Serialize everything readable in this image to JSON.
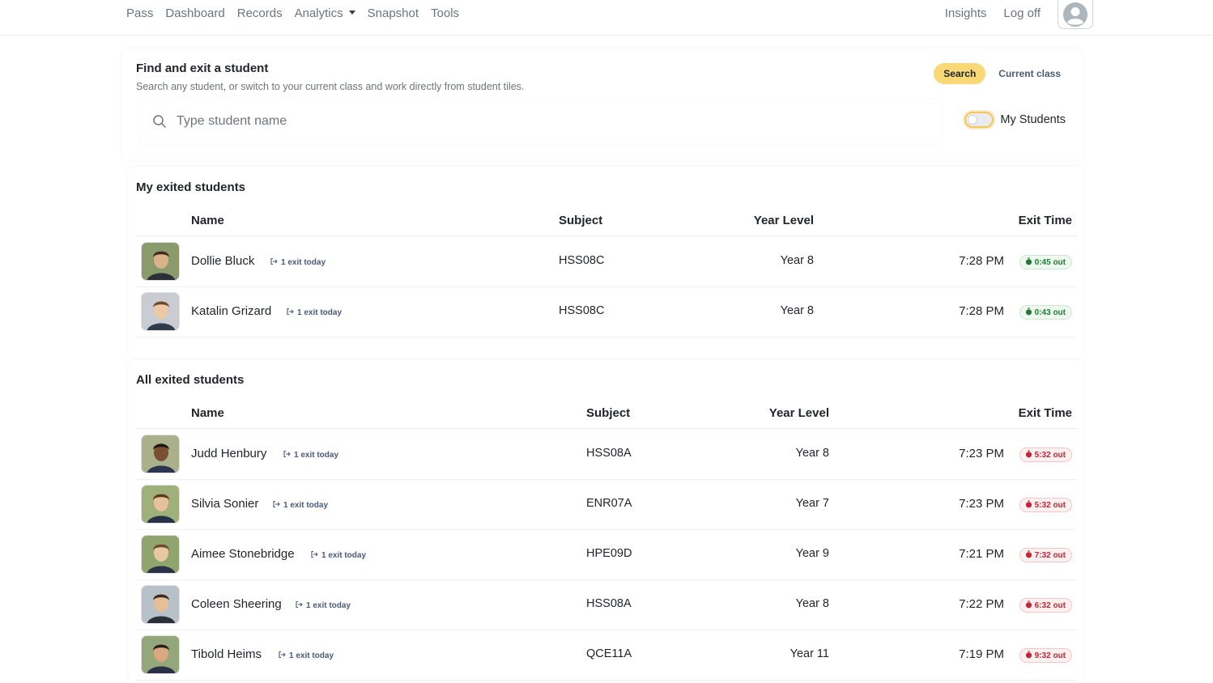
{
  "nav": {
    "left": [
      "Pass",
      "Dashboard",
      "Records",
      "Analytics",
      "Snapshot",
      "Tools"
    ],
    "right": [
      "Insights",
      "Log off"
    ]
  },
  "search": {
    "title": "Find and exit a student",
    "subtitle": "Search any student, or switch to your current class and work directly from student tiles.",
    "modes": [
      "Search",
      "Current class"
    ],
    "placeholder": "Type student name",
    "toggle_label": "My Students"
  },
  "my_exited": {
    "title": "My exited students",
    "headers": [
      "Name",
      "Subject",
      "Year Level",
      "Exit Time"
    ],
    "rows": [
      {
        "name": "Dollie Bluck",
        "exits": "1 exit today",
        "subject": "HSS08C",
        "year": "Year 8",
        "time": "7:28 PM",
        "duration": "0:45 out",
        "status": "green"
      },
      {
        "name": "Katalin Grizard",
        "exits": "1 exit today",
        "subject": "HSS08C",
        "year": "Year 8",
        "time": "7:28 PM",
        "duration": "0:43 out",
        "status": "green"
      }
    ]
  },
  "all_exited": {
    "title": "All exited students",
    "headers": [
      "Name",
      "Subject",
      "Year Level",
      "Exit Time"
    ],
    "rows": [
      {
        "name": "Judd Henbury",
        "exits": "1 exit today",
        "subject": "HSS08A",
        "year": "Year 8",
        "time": "7:23 PM",
        "duration": "5:32 out",
        "status": "red"
      },
      {
        "name": "Silvia Sonier",
        "exits": "1 exit today",
        "subject": "ENR07A",
        "year": "Year 7",
        "time": "7:23 PM",
        "duration": "5:32 out",
        "status": "red"
      },
      {
        "name": "Aimee Stonebridge",
        "exits": "1 exit today",
        "subject": "HPE09D",
        "year": "Year 9",
        "time": "7:21 PM",
        "duration": "7:32 out",
        "status": "red"
      },
      {
        "name": "Coleen Sheering",
        "exits": "1 exit today",
        "subject": "HSS08A",
        "year": "Year 8",
        "time": "7:22 PM",
        "duration": "6:32 out",
        "status": "red"
      },
      {
        "name": "Tibold Heims",
        "exits": "1 exit today",
        "subject": "QCE11A",
        "year": "Year 11",
        "time": "7:19 PM",
        "duration": "9:32 out",
        "status": "red"
      }
    ]
  },
  "colors": {
    "accent": "#f9d976",
    "status_green": "#1e7b34",
    "status_red": "#c82333"
  }
}
